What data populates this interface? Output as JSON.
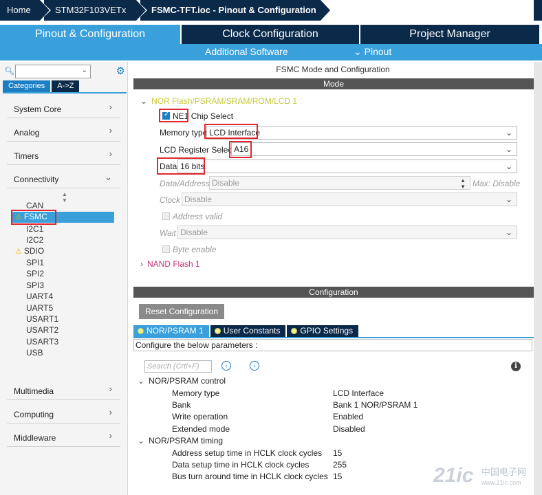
{
  "breadcrumb": {
    "items": [
      "Home",
      "STM32F103VETx",
      "FSMC-TFT.ioc - Pinout & Configuration"
    ]
  },
  "main_tabs": {
    "pinout": "Pinout & Configuration",
    "clock": "Clock Configuration",
    "project": "Project Manager"
  },
  "sub_tabs": {
    "additional": "Additional Software",
    "pinout": "Pinout"
  },
  "left": {
    "category_tabs": [
      "Categories",
      "A->Z"
    ],
    "groups": {
      "system_core": "System Core",
      "analog": "Analog",
      "timers": "Timers",
      "connectivity": "Connectivity",
      "multimedia": "Multimedia",
      "computing": "Computing",
      "middleware": "Middleware"
    },
    "connectivity_items": [
      "CAN",
      "FSMC",
      "I2C1",
      "I2C2",
      "SDIO",
      "SPI1",
      "SPI2",
      "SPI3",
      "UART4",
      "UART5",
      "USART1",
      "USART2",
      "USART3",
      "USB"
    ]
  },
  "mode_panel": {
    "title": "FSMC Mode and Configuration",
    "mode_bar": "Mode",
    "nor_section": "NOR Flash/PSRAM/SRAM/ROM/LCD 1",
    "ne1_value": "NE1",
    "ne1_label": "Chip Select",
    "memory_type_label": "Memory type",
    "memory_type_value": "LCD Interface",
    "lcd_reg_label": "LCD Register Select",
    "lcd_reg_value": "A16",
    "data_label": "Data",
    "data_value": "16 bits",
    "data_address_label": "Data/Address",
    "data_address_value": "Disable",
    "data_address_max": "Max: Disable",
    "clock_label": "Clock",
    "clock_value": "Disable",
    "address_valid_label": "Address valid",
    "wait_label": "Wait",
    "wait_value": "Disable",
    "byte_enable_label": "Byte enable",
    "nand_section": "NAND Flash 1"
  },
  "config_panel": {
    "title": "Configuration",
    "reset_button": "Reset Configuration",
    "tabs": [
      "NOR/PSRAM 1",
      "User Constants",
      "GPIO Settings"
    ],
    "hint": "Configure the below parameters :",
    "search_placeholder": "Search (Crtl+F)",
    "control_section": "NOR/PSRAM control",
    "control_rows": [
      {
        "key": "Memory type",
        "value": "LCD Interface"
      },
      {
        "key": "Bank",
        "value": "Bank 1 NOR/PSRAM 1"
      },
      {
        "key": "Write operation",
        "value": "Enabled"
      },
      {
        "key": "Extended mode",
        "value": "Disabled"
      }
    ],
    "timing_section": "NOR/PSRAM timing",
    "timing_rows": [
      {
        "key": "Address setup time in HCLK clock cycles",
        "value": "15"
      },
      {
        "key": "Data setup time in HCLK clock cycles",
        "value": "255"
      },
      {
        "key": "Bus turn around time in HCLK clock cycles",
        "value": "15"
      }
    ]
  },
  "watermark": {
    "brand": "21ic",
    "cn_line1": "中国电子网",
    "cn_line2": "www.21ic.com"
  },
  "colors": {
    "navy": "#0b2a4a",
    "accent": "#3aa0dc",
    "highlight": "#e0262f",
    "section_yellow": "#c8c83a",
    "nand_pink": "#c4307a"
  }
}
